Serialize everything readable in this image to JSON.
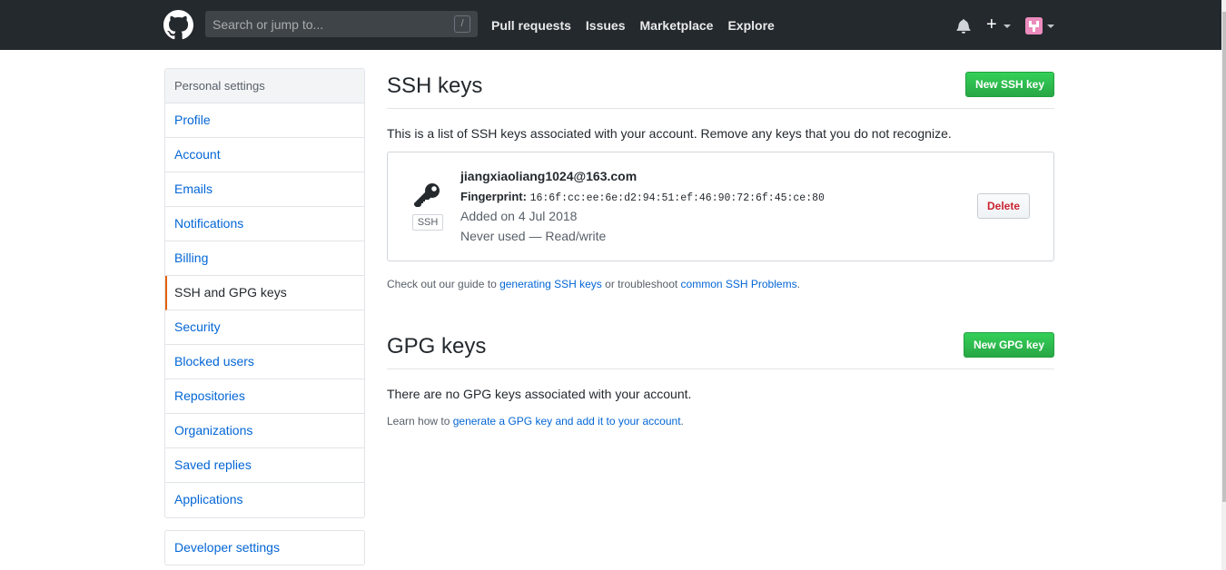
{
  "header": {
    "logo": "github-logo",
    "search_placeholder": "Search or jump to...",
    "search_shortcut": "/",
    "nav": [
      "Pull requests",
      "Issues",
      "Marketplace",
      "Explore"
    ],
    "icons": [
      "bell-icon",
      "plus-icon",
      "avatar"
    ],
    "plus_label": "+"
  },
  "sidebar": {
    "heading": "Personal settings",
    "items": [
      {
        "label": "Profile",
        "selected": false
      },
      {
        "label": "Account",
        "selected": false
      },
      {
        "label": "Emails",
        "selected": false
      },
      {
        "label": "Notifications",
        "selected": false
      },
      {
        "label": "Billing",
        "selected": false
      },
      {
        "label": "SSH and GPG keys",
        "selected": true
      },
      {
        "label": "Security",
        "selected": false
      },
      {
        "label": "Blocked users",
        "selected": false
      },
      {
        "label": "Repositories",
        "selected": false
      },
      {
        "label": "Organizations",
        "selected": false
      },
      {
        "label": "Saved replies",
        "selected": false
      },
      {
        "label": "Applications",
        "selected": false
      }
    ],
    "developer_settings": "Developer settings",
    "selected_accent": "#e36209"
  },
  "ssh": {
    "title": "SSH keys",
    "new_button": "New SSH key",
    "description": "This is a list of SSH keys associated with your account. Remove any keys that you do not recognize.",
    "keys": [
      {
        "title": "jiangxiaoliang1024@163.com",
        "fingerprint_label": "Fingerprint:",
        "fingerprint": "16:6f:cc:ee:6e:d2:94:51:ef:46:90:72:6f:45:ce:80",
        "added": "Added on 4 Jul 2018",
        "usage": "Never used — Read/write",
        "type_label": "SSH",
        "delete_label": "Delete"
      }
    ],
    "guide": {
      "prefix": "Check out our guide to ",
      "link1": "generating SSH keys",
      "middle": " or troubleshoot ",
      "link2": "common SSH Problems",
      "suffix": "."
    }
  },
  "gpg": {
    "title": "GPG keys",
    "new_button": "New GPG key",
    "empty": "There are no GPG keys associated with your account.",
    "learn_prefix": "Learn how to ",
    "learn_link": "generate a GPG key and add it to your account",
    "learn_suffix": "."
  },
  "colors": {
    "header_bg": "#24292e",
    "link": "#0366d6",
    "primary_button": "#28a745",
    "danger": "#cb2431"
  }
}
